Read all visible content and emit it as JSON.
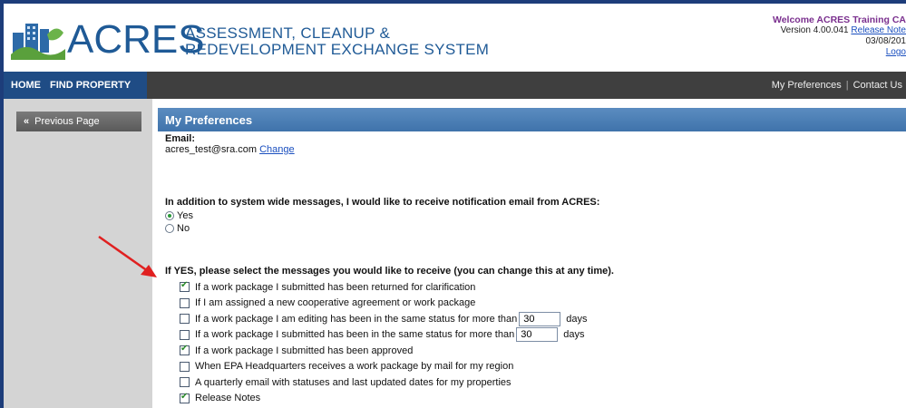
{
  "header": {
    "logo_text": "ACRES",
    "subtitle_line1": "ASSESSMENT, CLEANUP &",
    "subtitle_line2": "REDEVELOPMENT EXCHANGE SYSTEM",
    "welcome": "Welcome ACRES Training CA",
    "version": "Version 4.00.041",
    "release_notes_link": "Release Note",
    "date": "03/08/201",
    "logout_link": "Logo"
  },
  "nav": {
    "home": "HOME",
    "find_property": "FIND PROPERTY",
    "my_preferences": "My Preferences",
    "separator": "|",
    "contact_us": "Contact Us"
  },
  "sidebar": {
    "previous_page": "Previous Page",
    "chevron": "«"
  },
  "main": {
    "title": "My Preferences",
    "email_label": "Email:",
    "email_value": "acres_test@sra.com",
    "change_link": "Change",
    "notification_question": "In addition to system wide messages, I would like to receive notification email from ACRES:",
    "radio_yes": "Yes",
    "radio_no": "No",
    "messages_heading": "If YES, please select the messages you would like to receive (you can change this at any time).",
    "options": [
      {
        "label": "If a work package I submitted has been returned for clarification",
        "checked": true
      },
      {
        "label": "If I am assigned a new cooperative agreement or work package",
        "checked": false
      },
      {
        "label": "If a work package I am editing has been in the same status for more than",
        "checked": false,
        "days_value": "30",
        "days_label": "days"
      },
      {
        "label": "If a work package I submitted has been in the same status for more than",
        "checked": false,
        "days_value": "30",
        "days_label": "days"
      },
      {
        "label": "If a work package I submitted has been approved",
        "checked": true
      },
      {
        "label": "When EPA Headquarters receives a work package by mail for my region",
        "checked": false
      },
      {
        "label": "A quarterly email with statuses and last updated dates for my properties",
        "checked": false
      },
      {
        "label": "Release Notes",
        "checked": true
      }
    ]
  },
  "colors": {
    "nav_bg": "#3f3f3f",
    "nav_left_bg": "#1f4c85",
    "panel_title_bg": "#4a7fb5",
    "logo_blue": "#1f5a96",
    "welcome_purple": "#7a2f8e",
    "annotation_arrow": "#e02020"
  },
  "icons": {
    "logo": "buildings-logo-icon",
    "arrow": "red-annotation-arrow-icon"
  }
}
